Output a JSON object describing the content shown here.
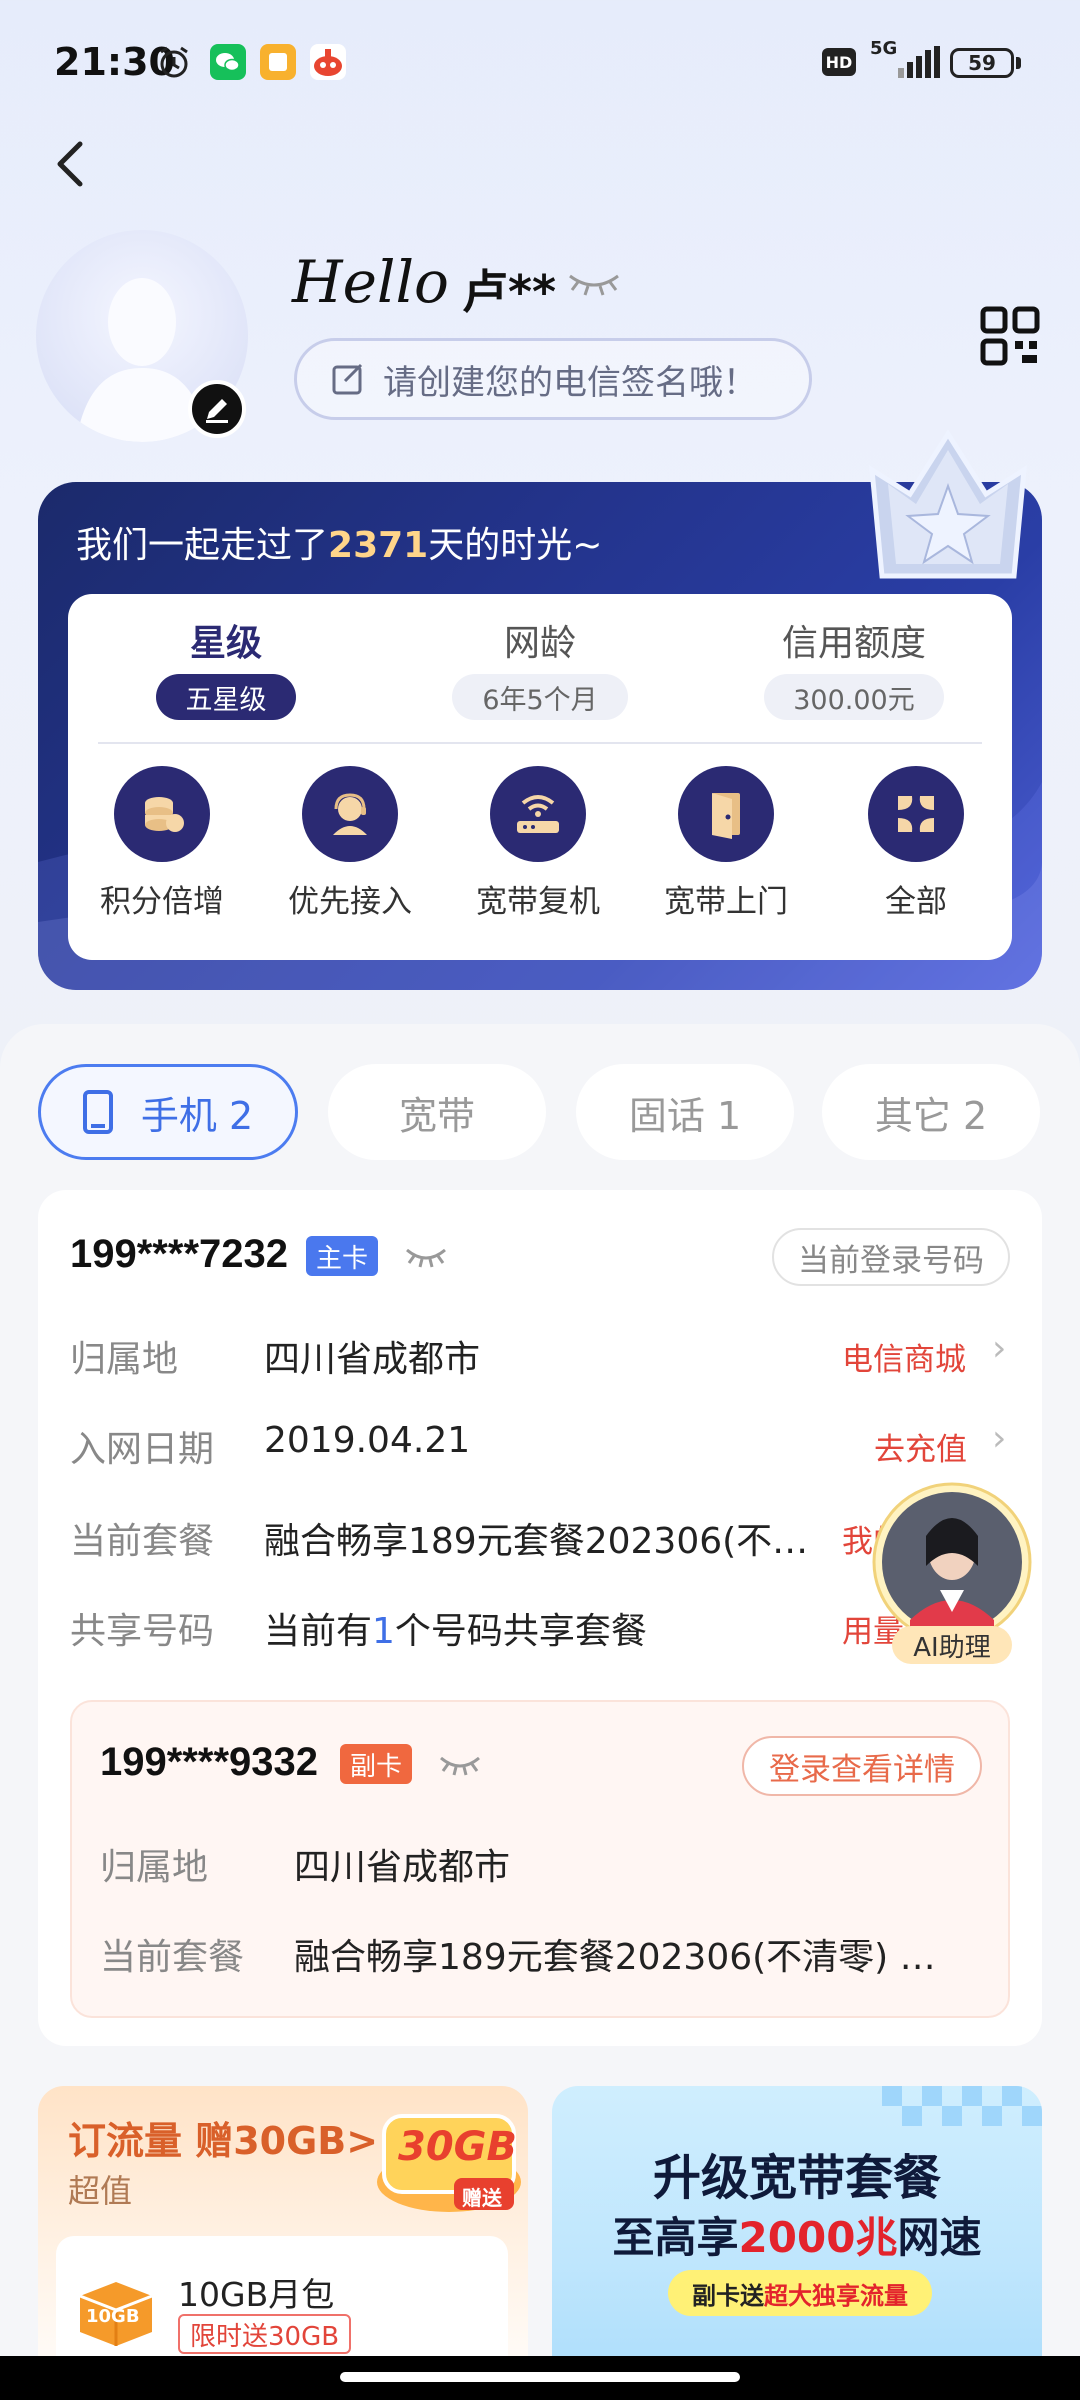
{
  "status_bar": {
    "time": "21:30",
    "network": "5G",
    "battery": "59",
    "hd": "HD"
  },
  "profile": {
    "hello": "Hello",
    "name": "卢**",
    "signature_placeholder": "请创建您的电信签名哦！"
  },
  "membership": {
    "title_prefix": "我们一起走过了",
    "days": "2371",
    "title_suffix": "天的时光~",
    "stats": [
      {
        "label": "星级",
        "value": "五星级"
      },
      {
        "label": "网龄",
        "value": "6年5个月"
      },
      {
        "label": "信用额度",
        "value": "300.00元"
      }
    ],
    "services": [
      {
        "label": "积分倍增",
        "icon": "coins-icon"
      },
      {
        "label": "优先接入",
        "icon": "agent-icon"
      },
      {
        "label": "宽带复机",
        "icon": "router-icon"
      },
      {
        "label": "宽带上门",
        "icon": "door-icon"
      },
      {
        "label": "全部",
        "icon": "grid-icon"
      }
    ]
  },
  "tabs": [
    {
      "label": "手机 2",
      "active": true
    },
    {
      "label": "宽带",
      "active": false
    },
    {
      "label": "固话 1",
      "active": false
    },
    {
      "label": "其它 2",
      "active": false
    }
  ],
  "main_line": {
    "number": "199****7232",
    "tag": "主卡",
    "login_label": "当前登录号码",
    "rows": [
      {
        "label": "归属地",
        "value": "四川省成都市",
        "link": "电信商城"
      },
      {
        "label": "入网日期",
        "value": "2019.04.21",
        "link": "去充值"
      },
      {
        "label": "当前套餐",
        "value": "融合畅享189元套餐202306(不…",
        "link": "我的"
      },
      {
        "label": "共享号码",
        "value_prefix": "当前有",
        "value_count": "1",
        "value_suffix": "个号码共享套餐",
        "link": "用量"
      }
    ]
  },
  "ai_assistant": {
    "label": "AI助理"
  },
  "sub_line": {
    "number": "199****9332",
    "tag": "副卡",
    "detail_label": "登录查看详情",
    "rows": [
      {
        "label": "归属地",
        "value": "四川省成都市"
      },
      {
        "label": "当前套餐",
        "value": "融合畅享189元套餐202306(不清零) …"
      }
    ]
  },
  "promo_left": {
    "title": "订流量 赠30GB>",
    "subtitle": "超值",
    "badge_big": "30GB",
    "badge_small": "赠送",
    "box_label": "10GB",
    "item": "10GB月包",
    "item_tag": "限时送30GB"
  },
  "promo_right": {
    "line1": "升级宽带套餐",
    "line2_prefix": "至高享",
    "line2_highlight": "2000兆",
    "line2_suffix": "网速",
    "pill_prefix": "副卡送",
    "pill_highlight": "超大独享流量"
  },
  "colors": {
    "accent": "#3f6fe6",
    "card_blue": "#23338a",
    "link_red": "#e2453a",
    "sub_tag": "#f0683f",
    "main_tag": "#4a78ee"
  }
}
